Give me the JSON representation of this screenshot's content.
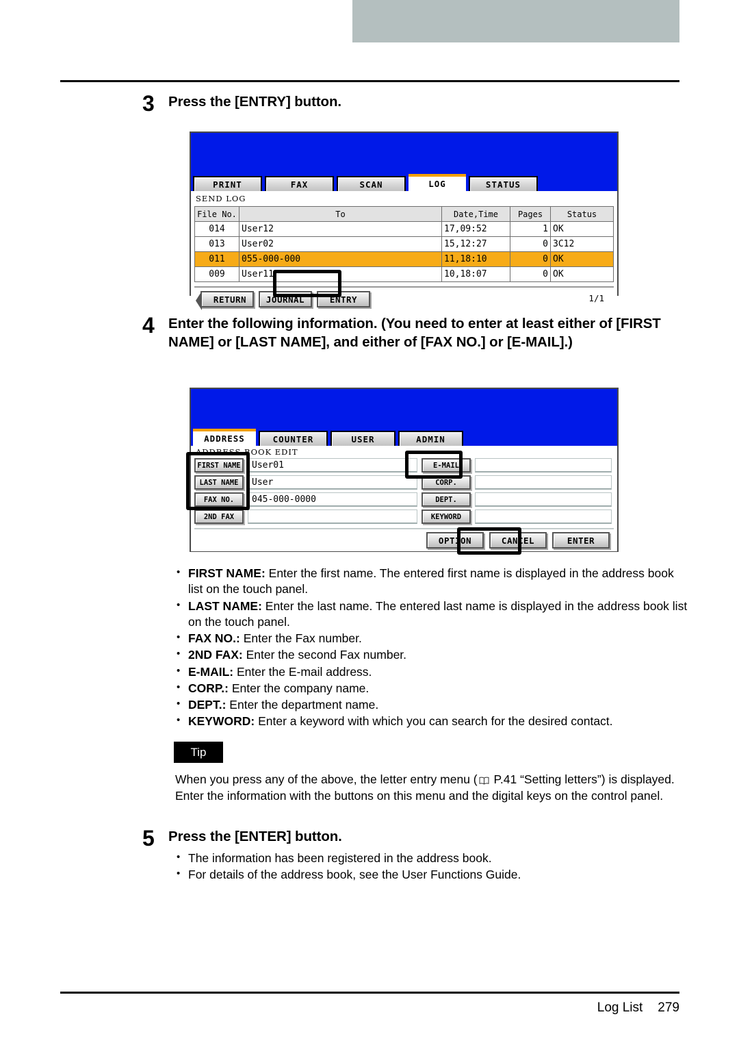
{
  "page": {
    "footer_label": "Log List",
    "footer_page": "279"
  },
  "steps": {
    "three": {
      "number": "3",
      "text": "Press the [ENTRY] button."
    },
    "four": {
      "number": "4",
      "text": "Enter the following information. (You need to enter at least either of [FIRST NAME] or [LAST NAME], and either of [FAX NO.] or [E-MAIL].)"
    },
    "five": {
      "number": "5",
      "text": "Press the [ENTER] button.",
      "bullets": [
        "The information has been registered in the address book.",
        "For details of the address book, see the User Functions Guide."
      ]
    }
  },
  "log_screen": {
    "tabs": [
      {
        "label": "PRINT",
        "active": false
      },
      {
        "label": "FAX",
        "active": false
      },
      {
        "label": "SCAN",
        "active": false
      },
      {
        "label": "LOG",
        "active": true
      },
      {
        "label": "STATUS",
        "active": false
      }
    ],
    "caption": "SEND LOG",
    "table": {
      "headers": [
        "File No.",
        "To",
        "Date,Time",
        "Pages",
        "Status"
      ],
      "rows": [
        {
          "file": "014",
          "to": "User12",
          "date": "17,09:52",
          "pages": "1",
          "status": "OK",
          "selected": false
        },
        {
          "file": "013",
          "to": "User02",
          "date": "15,12:27",
          "pages": "0",
          "status": "3C12",
          "selected": false
        },
        {
          "file": "011",
          "to": "055-000-000",
          "date": "11,18:10",
          "pages": "0",
          "status": "OK",
          "selected": true
        },
        {
          "file": "009",
          "to": "User11",
          "date": "10,18:07",
          "pages": "0",
          "status": "OK",
          "selected": false
        }
      ]
    },
    "buttons": {
      "return": "RETURN",
      "journal": "JOURNAL",
      "entry": "ENTRY"
    },
    "page_count": "1/1",
    "accent_color": "#f4a000",
    "selected_row_color": "#f7ab18",
    "header_color": "#0019e8"
  },
  "address_screen": {
    "tabs": [
      {
        "label": "ADDRESS",
        "active": true
      },
      {
        "label": "COUNTER",
        "active": false
      },
      {
        "label": "USER",
        "active": false
      },
      {
        "label": "ADMIN",
        "active": false
      }
    ],
    "caption": "ADDRESS BOOK EDIT",
    "fields": [
      {
        "left_label": "FIRST NAME",
        "left_value": "User01",
        "right_label": "E-MAIL",
        "right_value": ""
      },
      {
        "left_label": "LAST NAME",
        "left_value": "User",
        "right_label": "CORP.",
        "right_value": ""
      },
      {
        "left_label": "FAX NO.",
        "left_value": "045-000-0000",
        "right_label": "DEPT.",
        "right_value": ""
      },
      {
        "left_label": "2ND FAX",
        "left_value": "",
        "right_label": "KEYWORD",
        "right_value": ""
      }
    ],
    "buttons": {
      "option": "OPTION",
      "cancel": "CANCEL",
      "enter": "ENTER"
    },
    "accent_color": "#f4a000",
    "header_color": "#0019e8"
  },
  "field_descriptions": [
    {
      "term": "FIRST NAME:",
      "desc": " Enter the first name. The entered first name is displayed in the address book list on the touch panel."
    },
    {
      "term": "LAST NAME:",
      "desc": " Enter the last name. The entered last name is displayed in the address book list on the touch panel."
    },
    {
      "term": "FAX NO.:",
      "desc": " Enter the Fax number."
    },
    {
      "term": "2ND FAX:",
      "desc": " Enter the second Fax number."
    },
    {
      "term": "E-MAIL:",
      "desc": " Enter the E-mail address."
    },
    {
      "term": "CORP.:",
      "desc": " Enter the company name."
    },
    {
      "term": "DEPT.:",
      "desc": " Enter the department name."
    },
    {
      "term": "KEYWORD:",
      "desc": " Enter a keyword with which you can search for the desired contact."
    }
  ],
  "tip": {
    "label": "Tip",
    "text_before": "When you press any of the above, the letter entry menu (",
    "reference": " P.41 “Setting letters”",
    "text_after": ") is displayed. Enter the information with the buttons on this menu and the digital keys on the control panel."
  }
}
